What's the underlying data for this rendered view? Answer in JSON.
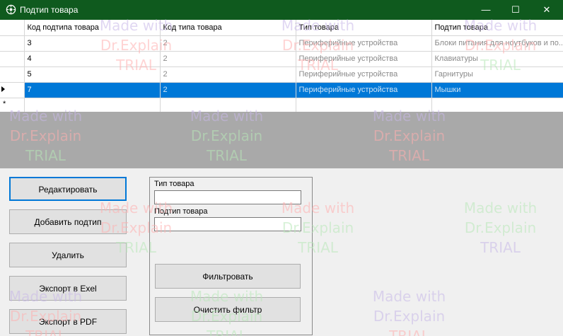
{
  "window": {
    "title": "Подтип товара",
    "icon": "app-gear-icon",
    "controls": [
      "minimize-icon",
      "maximize-icon",
      "close-icon"
    ]
  },
  "grid": {
    "columns": [
      "Код подтипа товара",
      "Код типа товара",
      "Тип товара",
      "Подтип товара"
    ],
    "rows": [
      [
        "3",
        "2",
        "Периферийные устройства",
        "Блоки питания для ноутбуков и по..."
      ],
      [
        "4",
        "2",
        "Периферийные устройства",
        "Клавиатуры"
      ],
      [
        "5",
        "2",
        "Периферийные устройства",
        "Гарнитуры"
      ],
      [
        "7",
        "2",
        "Периферийные устройства",
        "Мышки"
      ]
    ],
    "selected_row": 3
  },
  "buttons": {
    "edit": "Редактировать",
    "add": "Добавить подтип",
    "delete": "Удалить",
    "export_excel": "Экспорт в Exel",
    "export_pdf": "Экспорт в PDF"
  },
  "filter": {
    "type_label": "Тип товара",
    "type_value": "",
    "subtype_label": "Подтип товара",
    "subtype_value": "",
    "filter_button": "Фильтровать",
    "clear_button": "Очистить фильтр"
  },
  "watermark": {
    "line1": "Made with",
    "line2": "Dr.Explain",
    "line3": "TRIAL"
  },
  "colors": {
    "titlebar": "#0f5a1e",
    "selection": "#0078d7"
  }
}
